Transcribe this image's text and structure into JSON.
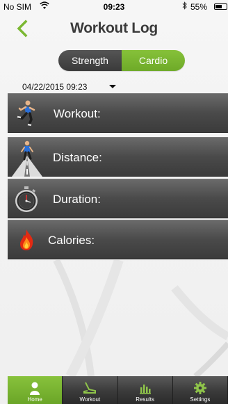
{
  "status_bar": {
    "carrier": "No SIM",
    "time": "09:23",
    "battery_percent": "55%",
    "wifi_icon": "wifi-icon",
    "bluetooth_icon": "bluetooth-icon",
    "battery_icon": "battery-icon"
  },
  "header": {
    "title": "Workout Log",
    "back_icon": "chevron-left-icon"
  },
  "segmented": {
    "options": [
      "Strength",
      "Cardio"
    ],
    "selected": "Cardio"
  },
  "date_picker": {
    "value": "04/22/2015 09:23",
    "icon": "caret-down-icon"
  },
  "fields": [
    {
      "label": "Workout:",
      "icon": "runner-icon"
    },
    {
      "label": "Distance:",
      "icon": "road-runner-icon"
    },
    {
      "label": "Duration:",
      "icon": "stopwatch-icon"
    },
    {
      "label": "Calories:",
      "icon": "flame-icon"
    }
  ],
  "tabs": [
    {
      "label": "Home",
      "icon": "person-icon"
    },
    {
      "label": "Workout",
      "icon": "treadmill-icon"
    },
    {
      "label": "Results",
      "icon": "bar-chart-icon"
    },
    {
      "label": "Settings",
      "icon": "gear-icon"
    }
  ],
  "colors": {
    "accent_green": "#7bb832",
    "row_dark": "#444444",
    "title_text": "#3a3a3a"
  }
}
